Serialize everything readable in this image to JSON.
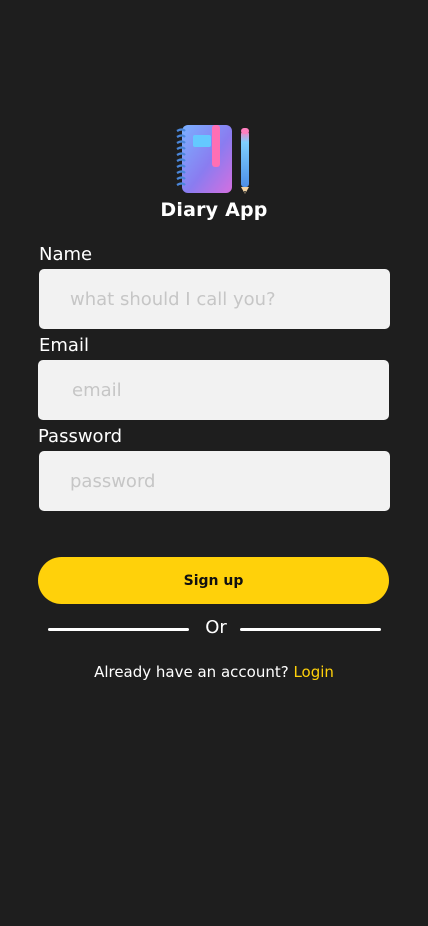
{
  "app": {
    "title": "Diary App",
    "logo_icon": "diary-notebook-pencil-icon"
  },
  "form": {
    "name": {
      "label": "Name",
      "placeholder": "what should I call you?",
      "value": ""
    },
    "email": {
      "label": "Email",
      "placeholder": "email",
      "value": ""
    },
    "password": {
      "label": "Password",
      "placeholder": "password",
      "value": ""
    },
    "submit_label": "Sign up"
  },
  "divider": {
    "text": "Or"
  },
  "footer": {
    "prompt": "Already have an account?",
    "link_label": "Login"
  },
  "colors": {
    "background": "#1e1e1e",
    "accent": "#ffd10a",
    "input_bg": "#f2f2f2",
    "placeholder": "#c6c6c6"
  }
}
